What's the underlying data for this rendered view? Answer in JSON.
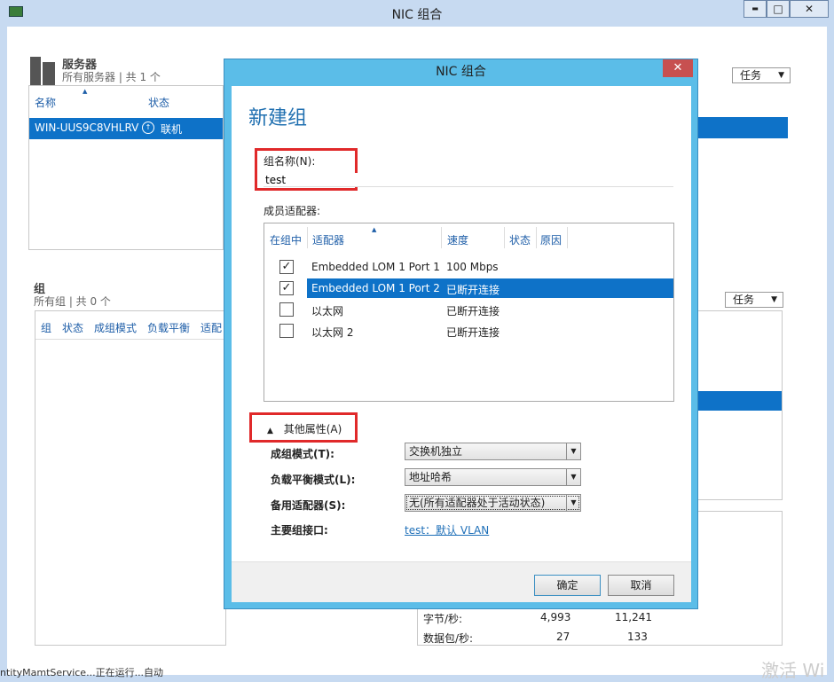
{
  "window": {
    "title": "NIC 组合",
    "min": "▬",
    "max": "□",
    "close": "✕"
  },
  "servers": {
    "title": "服务器",
    "subtitle": "所有服务器 | 共 1 个",
    "col_name": "名称",
    "col_state": "状态",
    "tasks": "任务",
    "row": {
      "name": "WIN-UUS9C8VHLRV",
      "state": "联机"
    }
  },
  "groups": {
    "title": "组",
    "subtitle": "所有组 | 共 0 个",
    "cols": [
      "组",
      "状态",
      "成组模式",
      "负载平衡",
      "适配"
    ],
    "tasks": "任务"
  },
  "stats": [
    {
      "label": "字节/秒:",
      "v1": "4,993",
      "v2": "11,241"
    },
    {
      "label": "数据包/秒:",
      "v1": "27",
      "v2": "133"
    }
  ],
  "status_bar": "ntityMamtService...正在运行...自动",
  "watermark": "激活 Wi",
  "dialog": {
    "title": "NIC 组合",
    "heading": "新建组",
    "team_name_label": "组名称(N):",
    "team_name_value": "test",
    "members_label": "成员适配器:",
    "cols": {
      "in_team": "在组中",
      "adapter": "适配器",
      "speed": "速度",
      "state": "状态",
      "reason": "原因"
    },
    "adapters": [
      {
        "checked": true,
        "name": "Embedded LOM 1 Port 1",
        "speed": "100 Mbps"
      },
      {
        "checked": true,
        "name": "Embedded LOM 1 Port 2",
        "speed": "已断开连接"
      },
      {
        "checked": false,
        "name": "以太网",
        "speed": "已断开连接"
      },
      {
        "checked": false,
        "name": "以太网 2",
        "speed": "已断开连接"
      }
    ],
    "more_props": "其他属性(A)",
    "team_mode_label": "成组模式(T):",
    "team_mode_value": "交换机独立",
    "lb_mode_label": "负载平衡模式(L):",
    "lb_mode_value": "地址哈希",
    "standby_label": "备用适配器(S):",
    "standby_value": "无(所有适配器处于活动状态)",
    "primary_label": "主要组接口:",
    "primary_value": "test：默认 VLAN",
    "ok": "确定",
    "cancel": "取消"
  },
  "colors": {
    "accent": "#0e72c8",
    "dialog_frame": "#5bbde8",
    "highlight": "#e0292a"
  }
}
